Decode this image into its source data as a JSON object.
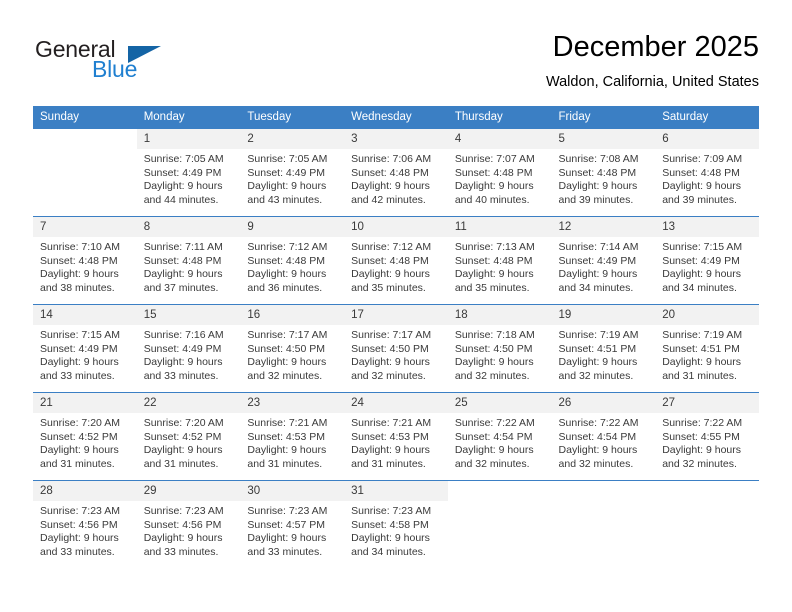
{
  "brand": {
    "name_part1": "General",
    "name_part2": "Blue",
    "accent_color": "#1f7fd0",
    "triangle_color": "#1464a5"
  },
  "header": {
    "month_title": "December 2025",
    "location": "Waldon, California, United States"
  },
  "calendar": {
    "header_color": "#3b7fc4",
    "weekdays": [
      "Sunday",
      "Monday",
      "Tuesday",
      "Wednesday",
      "Thursday",
      "Friday",
      "Saturday"
    ],
    "weeks": [
      [
        {
          "day": "",
          "sunrise": "",
          "sunset": "",
          "daylight_line1": "",
          "daylight_line2": ""
        },
        {
          "day": "1",
          "sunrise": "Sunrise: 7:05 AM",
          "sunset": "Sunset: 4:49 PM",
          "daylight_line1": "Daylight: 9 hours",
          "daylight_line2": "and 44 minutes."
        },
        {
          "day": "2",
          "sunrise": "Sunrise: 7:05 AM",
          "sunset": "Sunset: 4:49 PM",
          "daylight_line1": "Daylight: 9 hours",
          "daylight_line2": "and 43 minutes."
        },
        {
          "day": "3",
          "sunrise": "Sunrise: 7:06 AM",
          "sunset": "Sunset: 4:48 PM",
          "daylight_line1": "Daylight: 9 hours",
          "daylight_line2": "and 42 minutes."
        },
        {
          "day": "4",
          "sunrise": "Sunrise: 7:07 AM",
          "sunset": "Sunset: 4:48 PM",
          "daylight_line1": "Daylight: 9 hours",
          "daylight_line2": "and 40 minutes."
        },
        {
          "day": "5",
          "sunrise": "Sunrise: 7:08 AM",
          "sunset": "Sunset: 4:48 PM",
          "daylight_line1": "Daylight: 9 hours",
          "daylight_line2": "and 39 minutes."
        },
        {
          "day": "6",
          "sunrise": "Sunrise: 7:09 AM",
          "sunset": "Sunset: 4:48 PM",
          "daylight_line1": "Daylight: 9 hours",
          "daylight_line2": "and 39 minutes."
        }
      ],
      [
        {
          "day": "7",
          "sunrise": "Sunrise: 7:10 AM",
          "sunset": "Sunset: 4:48 PM",
          "daylight_line1": "Daylight: 9 hours",
          "daylight_line2": "and 38 minutes."
        },
        {
          "day": "8",
          "sunrise": "Sunrise: 7:11 AM",
          "sunset": "Sunset: 4:48 PM",
          "daylight_line1": "Daylight: 9 hours",
          "daylight_line2": "and 37 minutes."
        },
        {
          "day": "9",
          "sunrise": "Sunrise: 7:12 AM",
          "sunset": "Sunset: 4:48 PM",
          "daylight_line1": "Daylight: 9 hours",
          "daylight_line2": "and 36 minutes."
        },
        {
          "day": "10",
          "sunrise": "Sunrise: 7:12 AM",
          "sunset": "Sunset: 4:48 PM",
          "daylight_line1": "Daylight: 9 hours",
          "daylight_line2": "and 35 minutes."
        },
        {
          "day": "11",
          "sunrise": "Sunrise: 7:13 AM",
          "sunset": "Sunset: 4:48 PM",
          "daylight_line1": "Daylight: 9 hours",
          "daylight_line2": "and 35 minutes."
        },
        {
          "day": "12",
          "sunrise": "Sunrise: 7:14 AM",
          "sunset": "Sunset: 4:49 PM",
          "daylight_line1": "Daylight: 9 hours",
          "daylight_line2": "and 34 minutes."
        },
        {
          "day": "13",
          "sunrise": "Sunrise: 7:15 AM",
          "sunset": "Sunset: 4:49 PM",
          "daylight_line1": "Daylight: 9 hours",
          "daylight_line2": "and 34 minutes."
        }
      ],
      [
        {
          "day": "14",
          "sunrise": "Sunrise: 7:15 AM",
          "sunset": "Sunset: 4:49 PM",
          "daylight_line1": "Daylight: 9 hours",
          "daylight_line2": "and 33 minutes."
        },
        {
          "day": "15",
          "sunrise": "Sunrise: 7:16 AM",
          "sunset": "Sunset: 4:49 PM",
          "daylight_line1": "Daylight: 9 hours",
          "daylight_line2": "and 33 minutes."
        },
        {
          "day": "16",
          "sunrise": "Sunrise: 7:17 AM",
          "sunset": "Sunset: 4:50 PM",
          "daylight_line1": "Daylight: 9 hours",
          "daylight_line2": "and 32 minutes."
        },
        {
          "day": "17",
          "sunrise": "Sunrise: 7:17 AM",
          "sunset": "Sunset: 4:50 PM",
          "daylight_line1": "Daylight: 9 hours",
          "daylight_line2": "and 32 minutes."
        },
        {
          "day": "18",
          "sunrise": "Sunrise: 7:18 AM",
          "sunset": "Sunset: 4:50 PM",
          "daylight_line1": "Daylight: 9 hours",
          "daylight_line2": "and 32 minutes."
        },
        {
          "day": "19",
          "sunrise": "Sunrise: 7:19 AM",
          "sunset": "Sunset: 4:51 PM",
          "daylight_line1": "Daylight: 9 hours",
          "daylight_line2": "and 32 minutes."
        },
        {
          "day": "20",
          "sunrise": "Sunrise: 7:19 AM",
          "sunset": "Sunset: 4:51 PM",
          "daylight_line1": "Daylight: 9 hours",
          "daylight_line2": "and 31 minutes."
        }
      ],
      [
        {
          "day": "21",
          "sunrise": "Sunrise: 7:20 AM",
          "sunset": "Sunset: 4:52 PM",
          "daylight_line1": "Daylight: 9 hours",
          "daylight_line2": "and 31 minutes."
        },
        {
          "day": "22",
          "sunrise": "Sunrise: 7:20 AM",
          "sunset": "Sunset: 4:52 PM",
          "daylight_line1": "Daylight: 9 hours",
          "daylight_line2": "and 31 minutes."
        },
        {
          "day": "23",
          "sunrise": "Sunrise: 7:21 AM",
          "sunset": "Sunset: 4:53 PM",
          "daylight_line1": "Daylight: 9 hours",
          "daylight_line2": "and 31 minutes."
        },
        {
          "day": "24",
          "sunrise": "Sunrise: 7:21 AM",
          "sunset": "Sunset: 4:53 PM",
          "daylight_line1": "Daylight: 9 hours",
          "daylight_line2": "and 31 minutes."
        },
        {
          "day": "25",
          "sunrise": "Sunrise: 7:22 AM",
          "sunset": "Sunset: 4:54 PM",
          "daylight_line1": "Daylight: 9 hours",
          "daylight_line2": "and 32 minutes."
        },
        {
          "day": "26",
          "sunrise": "Sunrise: 7:22 AM",
          "sunset": "Sunset: 4:54 PM",
          "daylight_line1": "Daylight: 9 hours",
          "daylight_line2": "and 32 minutes."
        },
        {
          "day": "27",
          "sunrise": "Sunrise: 7:22 AM",
          "sunset": "Sunset: 4:55 PM",
          "daylight_line1": "Daylight: 9 hours",
          "daylight_line2": "and 32 minutes."
        }
      ],
      [
        {
          "day": "28",
          "sunrise": "Sunrise: 7:23 AM",
          "sunset": "Sunset: 4:56 PM",
          "daylight_line1": "Daylight: 9 hours",
          "daylight_line2": "and 33 minutes."
        },
        {
          "day": "29",
          "sunrise": "Sunrise: 7:23 AM",
          "sunset": "Sunset: 4:56 PM",
          "daylight_line1": "Daylight: 9 hours",
          "daylight_line2": "and 33 minutes."
        },
        {
          "day": "30",
          "sunrise": "Sunrise: 7:23 AM",
          "sunset": "Sunset: 4:57 PM",
          "daylight_line1": "Daylight: 9 hours",
          "daylight_line2": "and 33 minutes."
        },
        {
          "day": "31",
          "sunrise": "Sunrise: 7:23 AM",
          "sunset": "Sunset: 4:58 PM",
          "daylight_line1": "Daylight: 9 hours",
          "daylight_line2": "and 34 minutes."
        },
        {
          "day": "",
          "sunrise": "",
          "sunset": "",
          "daylight_line1": "",
          "daylight_line2": ""
        },
        {
          "day": "",
          "sunrise": "",
          "sunset": "",
          "daylight_line1": "",
          "daylight_line2": ""
        },
        {
          "day": "",
          "sunrise": "",
          "sunset": "",
          "daylight_line1": "",
          "daylight_line2": ""
        }
      ]
    ]
  }
}
